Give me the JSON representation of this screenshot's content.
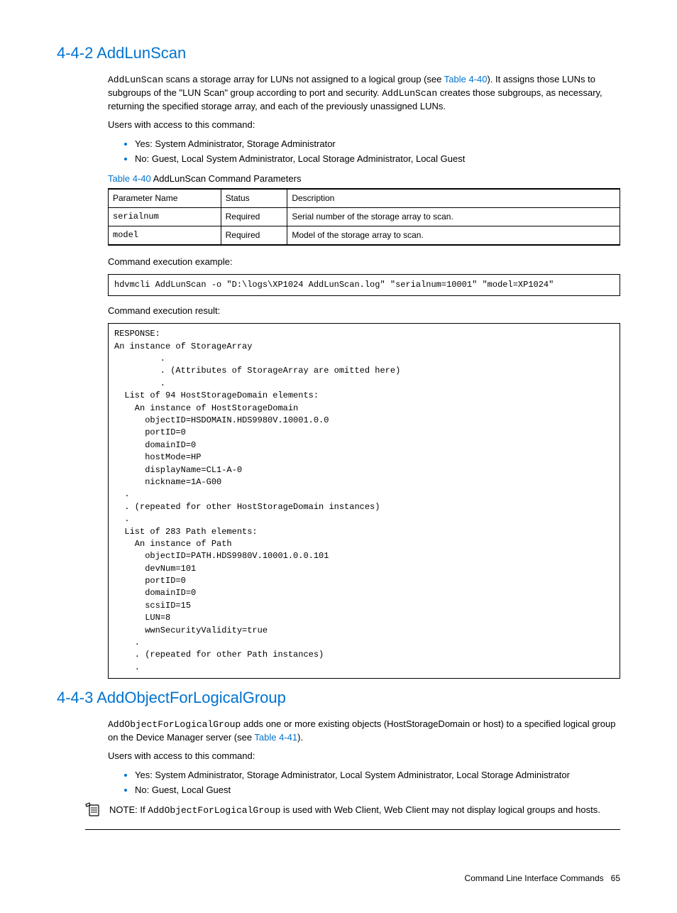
{
  "section1": {
    "heading": "4-4-2 AddLunScan",
    "para1_pre": "AddLunScan",
    "para1_mid1": " scans a storage array for LUNs not assigned to a logical group (see ",
    "para1_link": "Table 4-40",
    "para1_mid2": "). It assigns those LUNs to subgroups of the \"LUN Scan\" group according to port and security. ",
    "para1_mono2": "AddLunScan",
    "para1_tail": " creates those subgroups, as necessary, returning the specified storage array, and each of the previously unassigned LUNs.",
    "access_intro": "Users with access to this command:",
    "access": [
      "Yes: System Administrator, Storage Administrator",
      "No: Guest, Local System Administrator, Local Storage Administrator, Local Guest"
    ],
    "table_caption_link": "Table 4-40",
    "table_caption_rest": "  AddLunScan Command Parameters",
    "table": {
      "headers": [
        "Parameter Name",
        "Status",
        "Description"
      ],
      "rows": [
        {
          "name": "serialnum",
          "status": "Required",
          "desc": "Serial number of the storage array to scan."
        },
        {
          "name": "model",
          "status": "Required",
          "desc": "Model of the storage array to scan."
        }
      ]
    },
    "exec_example_label": "Command execution example:",
    "exec_example": "hdvmcli AddLunScan -o \"D:\\logs\\XP1024 AddLunScan.log\" \"serialnum=10001\" \"model=XP1024\"",
    "exec_result_label": "Command execution result:",
    "exec_result": "RESPONSE:\nAn instance of StorageArray\n         .\n         . (Attributes of StorageArray are omitted here)\n         .\n  List of 94 HostStorageDomain elements:\n    An instance of HostStorageDomain\n      objectID=HSDOMAIN.HDS9980V.10001.0.0\n      portID=0\n      domainID=0\n      hostMode=HP\n      displayName=CL1-A-0\n      nickname=1A-G00\n  .\n  . (repeated for other HostStorageDomain instances)\n  .\n  List of 283 Path elements:\n    An instance of Path\n      objectID=PATH.HDS9980V.10001.0.0.101\n      devNum=101\n      portID=0\n      domainID=0\n      scsiID=15\n      LUN=8\n      wwnSecurityValidity=true\n    .\n    . (repeated for other Path instances)\n    ."
  },
  "section2": {
    "heading": "4-4-3 AddObjectForLogicalGroup",
    "para1_pre": "AddObjectForLogicalGroup",
    "para1_mid1": " adds one or more existing objects (HostStorageDomain or host) to a specified logical group on the Device Manager server (see ",
    "para1_link": "Table 4-41",
    "para1_tail": ").",
    "access_intro": "Users with access to this command:",
    "access": [
      "Yes: System Administrator, Storage Administrator, Local System Administrator, Local Storage Administrator",
      "No: Guest, Local Guest"
    ],
    "note_label": "NOTE:  ",
    "note_pre": "If ",
    "note_mono": "AddObjectForLogicalGroup",
    "note_tail": " is used with Web Client, Web Client may not display logical groups and hosts."
  },
  "footer": {
    "text": "Command Line Interface Commands",
    "page": "65"
  }
}
